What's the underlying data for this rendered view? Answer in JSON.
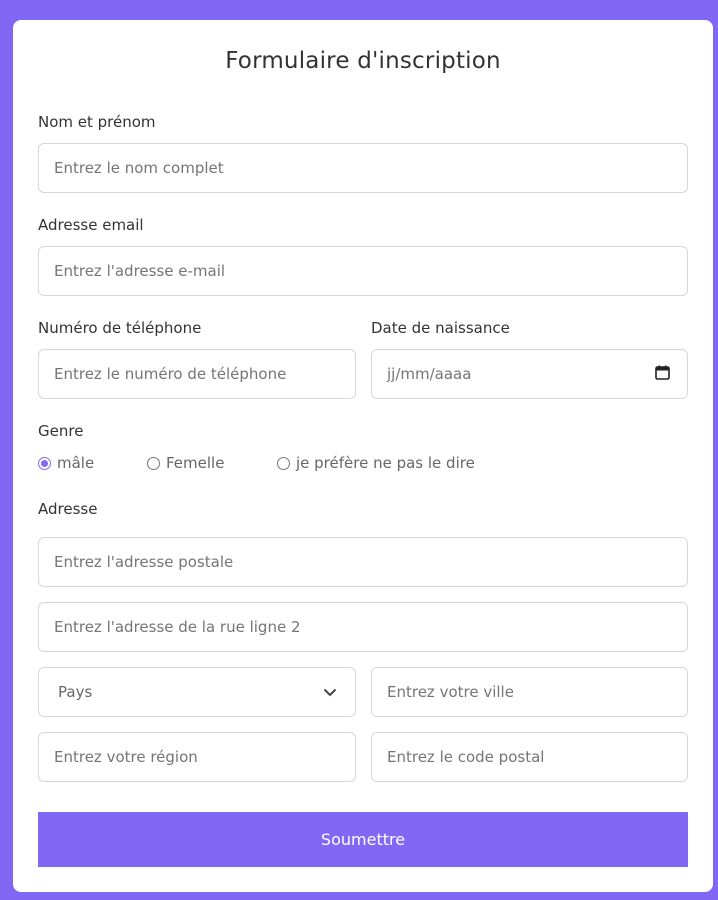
{
  "form": {
    "title": "Formulaire d'inscription",
    "full_name": {
      "label": "Nom et prénom",
      "placeholder": "Entrez le nom complet"
    },
    "email": {
      "label": "Adresse email",
      "placeholder": "Entrez l'adresse e-mail"
    },
    "phone": {
      "label": "Numéro de téléphone",
      "placeholder": "Entrez le numéro de téléphone"
    },
    "birth_date": {
      "label": "Date de naissance",
      "placeholder": "jj/mm/aaaa"
    },
    "gender": {
      "label": "Genre",
      "options": [
        "mâle",
        "Femelle",
        "je préfère ne pas le dire"
      ],
      "selected": "mâle"
    },
    "address": {
      "label": "Adresse",
      "line1_placeholder": "Entrez l'adresse postale",
      "line2_placeholder": "Entrez l'adresse de la rue ligne 2",
      "country_selected": "Pays",
      "city_placeholder": "Entrez votre ville",
      "region_placeholder": "Entrez votre région",
      "postal_placeholder": "Entrez le code postal"
    },
    "submit_label": "Soumettre"
  },
  "colors": {
    "accent": "#8068f5",
    "border": "#d7d7d7",
    "text": "#333333"
  },
  "icons": {
    "select_arrow": "chevron-down-icon",
    "date_picker": "calendar-icon"
  }
}
